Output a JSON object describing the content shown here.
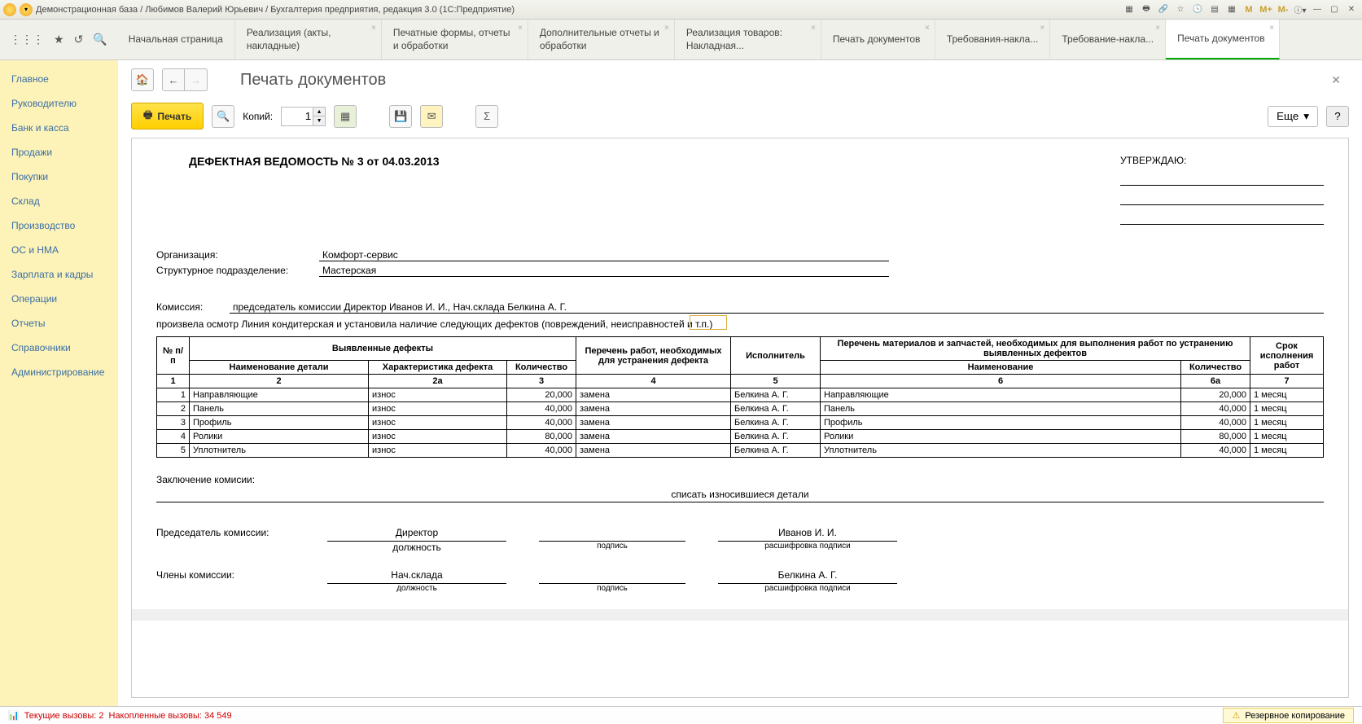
{
  "titlebar": {
    "text": "Демонстрационная база / Любимов Валерий Юрьевич / Бухгалтерия предприятия, редакция 3.0  (1С:Предприятие)",
    "mem1": "M",
    "mem2": "M+",
    "mem3": "M-"
  },
  "tabs": {
    "items": [
      {
        "label": "Начальная страница",
        "close": false
      },
      {
        "label": "Реализация (акты, накладные)",
        "close": true
      },
      {
        "label": "Печатные формы, отчеты и обработки",
        "close": true
      },
      {
        "label": "Дополнительные отчеты и обработки",
        "close": true
      },
      {
        "label": "Реализация товаров: Накладная...",
        "close": true
      },
      {
        "label": "Печать документов",
        "close": true
      },
      {
        "label": "Требования-накла...",
        "close": true
      },
      {
        "label": "Требование-накла...",
        "close": true
      },
      {
        "label": "Печать документов",
        "close": true,
        "active": true
      }
    ]
  },
  "sidebar": {
    "items": [
      "Главное",
      "Руководителю",
      "Банк и касса",
      "Продажи",
      "Покупки",
      "Склад",
      "Производство",
      "ОС и НМА",
      "Зарплата и кадры",
      "Операции",
      "Отчеты",
      "Справочники",
      "Администрирование"
    ]
  },
  "page": {
    "title": "Печать документов"
  },
  "toolbar": {
    "print": "Печать",
    "copies_label": "Копий:",
    "copies_value": "1",
    "more": "Еще",
    "help": "?"
  },
  "doc": {
    "title": "ДЕФЕКТНАЯ ВЕДОМОСТЬ № 3 от 04.03.2013",
    "approve": "УТВЕРЖДАЮ:",
    "org_label": "Организация:",
    "org_value": "Комфорт-сервис",
    "dept_label": "Структурное подразделение:",
    "dept_value": "Мастерская",
    "commission_label": "Комиссия:",
    "commission_value": "председатель комиссии Директор Иванов И. И., Нач.склада Белкина А. Г.",
    "inspect_text": "произвела осмотр Линия кондитерская и установила наличие следующих дефектов (повреждений, неисправностей и т.п.)",
    "table": {
      "headers": {
        "num": "№ п/п",
        "defects": "Выявленные дефекты",
        "detail_name": "Наименование детали",
        "characteristic": "Характеристика дефекта",
        "qty": "Количество",
        "works": "Перечень работ, необходимых для устранения дефекта",
        "executor": "Исполнитель",
        "materials": "Перечень материалов и запчастей, необходимых для выполнения работ по устранению выявленных дефектов",
        "mat_name": "Наименование",
        "mat_qty": "Количество",
        "deadline": "Срок исполнения работ",
        "c1": "1",
        "c2": "2",
        "c2a": "2а",
        "c3": "3",
        "c4": "4",
        "c5": "5",
        "c6": "6",
        "c6a": "6а",
        "c7": "7"
      },
      "rows": [
        {
          "n": "1",
          "detail": "Направляющие",
          "char": "износ",
          "qty": "20,000",
          "work": "замена",
          "exec": "Белкина А. Г.",
          "mat": "Направляющие",
          "mqty": "20,000",
          "term": "1 месяц"
        },
        {
          "n": "2",
          "detail": "Панель",
          "char": "износ",
          "qty": "40,000",
          "work": "замена",
          "exec": "Белкина А. Г.",
          "mat": "Панель",
          "mqty": "40,000",
          "term": "1 месяц"
        },
        {
          "n": "3",
          "detail": "Профиль",
          "char": "износ",
          "qty": "40,000",
          "work": "замена",
          "exec": "Белкина А. Г.",
          "mat": "Профиль",
          "mqty": "40,000",
          "term": "1 месяц"
        },
        {
          "n": "4",
          "detail": "Ролики",
          "char": "износ",
          "qty": "80,000",
          "work": "замена",
          "exec": "Белкина А. Г.",
          "mat": "Ролики",
          "mqty": "80,000",
          "term": "1 месяц"
        },
        {
          "n": "5",
          "detail": "Уплотнитель",
          "char": "износ",
          "qty": "40,000",
          "work": "замена",
          "exec": "Белкина А. Г.",
          "mat": "Уплотнитель",
          "mqty": "40,000",
          "term": "1 месяц"
        }
      ]
    },
    "conclusion_label": "Заключение комисии:",
    "conclusion_text": "списать износившиеся детали",
    "chairman_label": "Председатель комиссии:",
    "members_label": "Члены комиссии:",
    "chairman_pos": "Директор",
    "chairman_name": "Иванов И. И.",
    "member_pos": "Нач.склада",
    "member_name": "Белкина А. Г.",
    "hint_pos": "должность",
    "hint_sig": "подпись",
    "hint_name": "расшифровка подписи"
  },
  "status": {
    "prefix": "Текущие вызовы: 2",
    "suffix": "Накопленные вызовы: 34 549",
    "backup": "Резервное копирование"
  }
}
